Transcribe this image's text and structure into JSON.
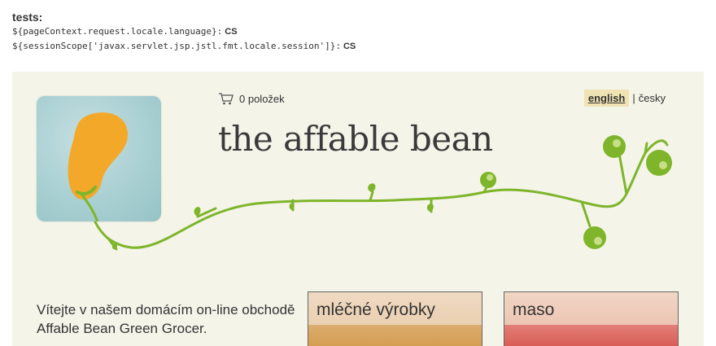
{
  "tests": {
    "title": "tests:",
    "lines": [
      {
        "expr": "${pageContext.request.locale.language}",
        "sep": ":",
        "value": "CS"
      },
      {
        "expr": "${sessionScope['javax.servlet.jsp.jstl.fmt.locale.session']}",
        "sep": ":",
        "value": "CS"
      }
    ]
  },
  "header": {
    "cart_count": "0 položek",
    "brand": "the affable bean",
    "lang_active": "english",
    "lang_separator": "|",
    "lang_other": "česky"
  },
  "main": {
    "welcome": "Vítejte v našem domácím on-line obchodě Affable Bean Green Grocer."
  },
  "categories": [
    {
      "label": "mléčné výrobky"
    },
    {
      "label": "maso"
    }
  ],
  "colors": {
    "panel_bg": "#f5f4e9",
    "vine": "#7eb52b",
    "bean": "#f4a82a",
    "lang_highlight": "#f0e3b3"
  },
  "icons": {
    "cart": "shopping-cart-icon"
  }
}
